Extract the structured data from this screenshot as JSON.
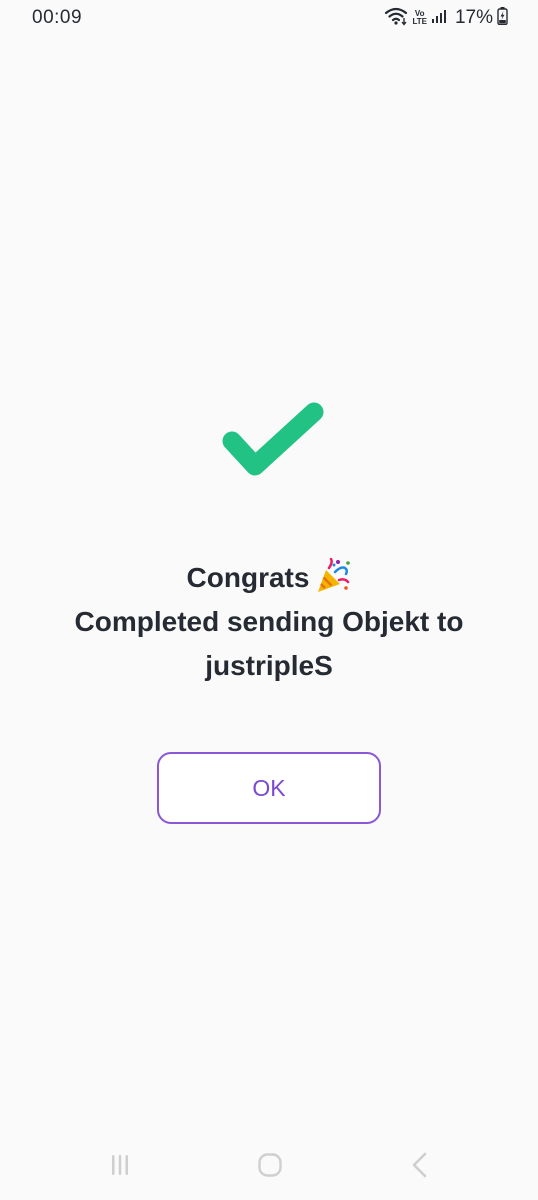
{
  "status_bar": {
    "time": "00:09",
    "battery": "17%",
    "icons": [
      "wifi-icon",
      "volte-icon",
      "signal-icon",
      "battery-charging-icon"
    ],
    "volte_label_top": "Vo",
    "volte_label_bottom": "LTE"
  },
  "content": {
    "check_icon": "check-icon",
    "congrats_text": "Congrats",
    "congrats_emoji": "party-popper-icon",
    "message_line1": "Completed sending Objekt to",
    "message_line2": "justripleS",
    "ok_label": "OK"
  },
  "colors": {
    "check": "#21c284",
    "accent": "#8a58d6",
    "text": "#262b33",
    "background": "#fafafa"
  },
  "nav_bar": {
    "icons": [
      "recents-icon",
      "home-icon",
      "back-icon"
    ]
  }
}
